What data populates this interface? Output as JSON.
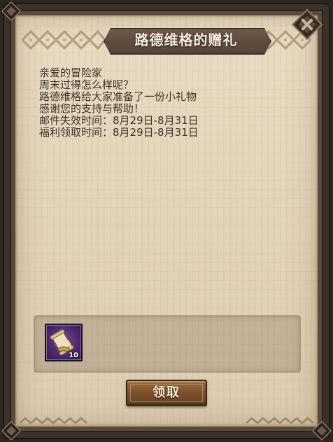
{
  "dialog": {
    "title": "路德维格的赠礼"
  },
  "message": {
    "lines": [
      "亲爱的冒险家",
      "周末过得怎么样呢？",
      "路德维格给大家准备了一份小礼物",
      "感谢您的支持与帮助！",
      "邮件失效时间：8月29日-8月31日",
      "福利领取时间：8月29日-8月31日"
    ]
  },
  "reward": {
    "items": [
      {
        "icon": "scroll-bundle-icon",
        "count": "10"
      }
    ]
  },
  "claim_button": {
    "label": "领取"
  },
  "close_button": {
    "icon": "close-icon"
  },
  "colors": {
    "parchment": "#e3d6bb",
    "frame": "#3b312a",
    "title_plate": "#5f4d40",
    "button": "#7a4e2c",
    "item_rarity_purple": "#4c2768",
    "text": "#3d332c"
  }
}
